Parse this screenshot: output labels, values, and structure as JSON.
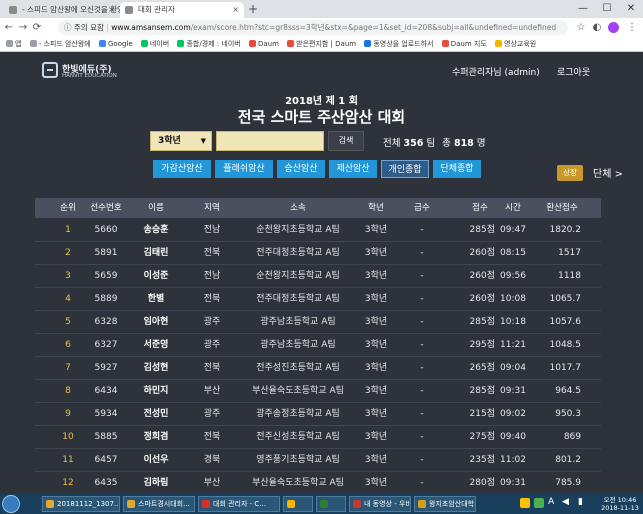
{
  "browser": {
    "tabs": [
      {
        "label": "- 스피드 암산왕에 오신것을 환영"
      },
      {
        "label": "대회 관리자"
      }
    ],
    "new_tab": "+",
    "window_controls": {
      "minimize": "—",
      "maximize": "☐",
      "close": "✕"
    },
    "address": {
      "secure_label": "주의 요함",
      "host": "www.amsansem.com",
      "path": "/exam/score.htm?stc=gr8sss=3학년&stx=&page=1&set_id=208&subj=all&undefined=undefined"
    },
    "bookmarks": [
      "앱",
      "- 스피드 암산왕에",
      "Google",
      "네이버",
      "종합/경제 : 네이버",
      "Daum",
      "받은편지함 | Daum",
      "동영상을 업로드하서",
      "Daum 지도",
      "영상교육원"
    ]
  },
  "header": {
    "logo_name": "한빛에듀(주)",
    "logo_sub": "HANVIT EDUCATION",
    "admin_label": "수퍼관리자님 (admin)",
    "logout_label": "로그아웃"
  },
  "contest": {
    "subtitle": "2018년 제 1 회",
    "title": "전국 스마트 주산암산 대회"
  },
  "search": {
    "grade_value": "3학년",
    "search_label": "검색",
    "stats_prefix": "전체",
    "teams": "356",
    "teams_unit": "팀",
    "total_prefix": "총",
    "people": "818",
    "people_unit": "명"
  },
  "nav_tabs": [
    "가감산암산",
    "플래쉬암산",
    "승산암산",
    "제산암산",
    "개인종합",
    "단체종합"
  ],
  "award_label": "상장",
  "group_label": "단체 >",
  "table": {
    "headers": [
      "순위",
      "선수번호",
      "이름",
      "지역",
      "소속",
      "학년",
      "급수",
      "점수",
      "시간",
      "환산점수"
    ],
    "rows": [
      {
        "rank": "1",
        "id": "5660",
        "name": "송승훈",
        "region": "전남",
        "org": "순천왕지초등학교 A팀",
        "grade": "3학년",
        "level": "-",
        "score": "285점",
        "time": "09:47",
        "conv": "1820.2"
      },
      {
        "rank": "2",
        "id": "5891",
        "name": "김태린",
        "region": "전북",
        "org": "전주대정초등학교 A팀",
        "grade": "3학년",
        "level": "-",
        "score": "260점",
        "time": "08:15",
        "conv": "1517"
      },
      {
        "rank": "3",
        "id": "5659",
        "name": "이성준",
        "region": "전남",
        "org": "순천왕지초등학교 A팀",
        "grade": "3학년",
        "level": "-",
        "score": "260점",
        "time": "09:56",
        "conv": "1118"
      },
      {
        "rank": "4",
        "id": "5889",
        "name": "한별",
        "region": "전북",
        "org": "전주대정초등학교 A팀",
        "grade": "3학년",
        "level": "-",
        "score": "260점",
        "time": "10:08",
        "conv": "1065.7"
      },
      {
        "rank": "5",
        "id": "6328",
        "name": "임아현",
        "region": "광주",
        "org": "광주남초등학교 A팀",
        "grade": "3학년",
        "level": "-",
        "score": "285점",
        "time": "10:18",
        "conv": "1057.6"
      },
      {
        "rank": "6",
        "id": "6327",
        "name": "서준영",
        "region": "광주",
        "org": "광주남초등학교 A팀",
        "grade": "3학년",
        "level": "-",
        "score": "295점",
        "time": "11:21",
        "conv": "1048.5"
      },
      {
        "rank": "7",
        "id": "5927",
        "name": "김성현",
        "region": "전북",
        "org": "전주성진초등학교 A팀",
        "grade": "3학년",
        "level": "-",
        "score": "265점",
        "time": "09:04",
        "conv": "1017.7"
      },
      {
        "rank": "8",
        "id": "6434",
        "name": "하민지",
        "region": "부산",
        "org": "부산율숙도초등학교 A팀",
        "grade": "3학년",
        "level": "-",
        "score": "285점",
        "time": "09:31",
        "conv": "964.5"
      },
      {
        "rank": "9",
        "id": "5934",
        "name": "전성민",
        "region": "광주",
        "org": "광주송정초등학교 A팀",
        "grade": "3학년",
        "level": "-",
        "score": "215점",
        "time": "09:02",
        "conv": "950.3"
      },
      {
        "rank": "10",
        "id": "5885",
        "name": "정희겸",
        "region": "전북",
        "org": "전주신성초등학교 A팀",
        "grade": "3학년",
        "level": "-",
        "score": "275점",
        "time": "09:40",
        "conv": "869"
      },
      {
        "rank": "11",
        "id": "6457",
        "name": "이선우",
        "region": "경북",
        "org": "영주풍기초등학교 A팀",
        "grade": "3학년",
        "level": "-",
        "score": "235점",
        "time": "11:02",
        "conv": "801.2"
      },
      {
        "rank": "12",
        "id": "6435",
        "name": "김하림",
        "region": "부산",
        "org": "부산율숙도초등학교 A팀",
        "grade": "3학년",
        "level": "-",
        "score": "280점",
        "time": "09:31",
        "conv": "785.9"
      }
    ]
  },
  "taskbar": {
    "items": [
      "20181112_1307...",
      "스마트경시대회...",
      "대회 관리자 - C...",
      "",
      "",
      "내 동영상 - 우비...",
      "왕지초암산대학..."
    ],
    "item_colors": [
      "#e0a82e",
      "#e0a82e",
      "#d93025",
      "#f4b400",
      "#2e7d32",
      "#c0392b",
      "#d4a017"
    ],
    "clock_time": "오전 10:46",
    "clock_date": "2018-11-13"
  }
}
